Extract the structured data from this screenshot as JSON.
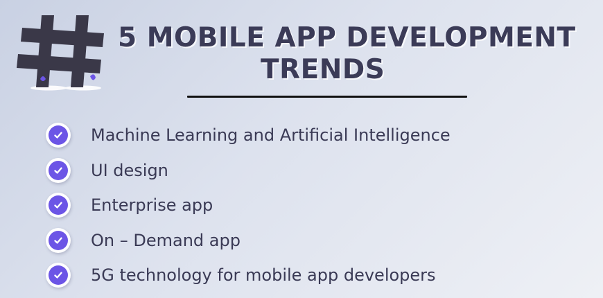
{
  "title": {
    "line1": "5  MOBILE APP DEVELOPMENT",
    "line2": "TRENDS"
  },
  "trends": [
    {
      "label": "Machine Learning and Artificial Intelligence"
    },
    {
      "label": "UI design"
    },
    {
      "label": "Enterprise app"
    },
    {
      "label": "On – Demand app"
    },
    {
      "label": "5G technology for mobile app developers"
    }
  ],
  "colors": {
    "accent": "#6c55e6",
    "text": "#3a3a55",
    "hash": "#3a3848"
  },
  "icons": {
    "hash": "hashtag-icon",
    "check": "checkmark-icon"
  }
}
